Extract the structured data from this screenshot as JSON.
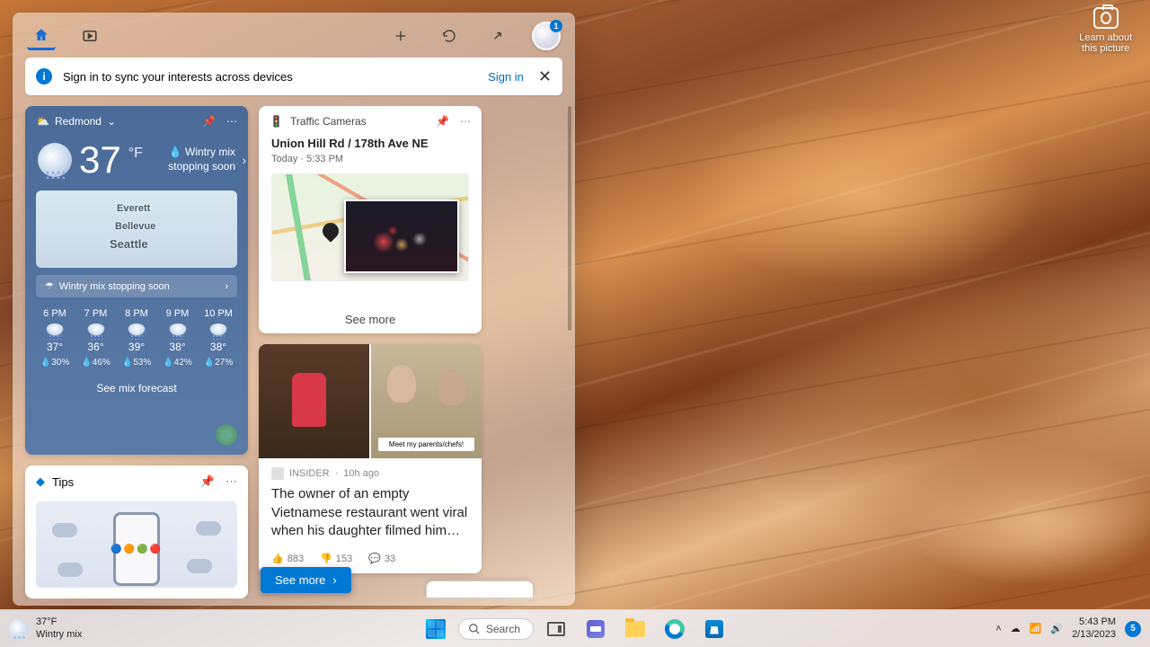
{
  "panel": {
    "signin_msg": "Sign in to sync your interests across devices",
    "signin_link": "Sign in",
    "avatar_badge": "1",
    "see_more_btn": "See more"
  },
  "weather": {
    "location": "Redmond",
    "temp": "37",
    "unit": "°F",
    "desc_icon": "💧",
    "desc": "Wintry mix stopping soon",
    "map_cities": {
      "everett": "Everett",
      "bellevue": "Bellevue",
      "seattle": "Seattle"
    },
    "banner": "Wintry mix stopping soon",
    "hourly": [
      {
        "time": "6 PM",
        "temp": "37°",
        "precip": "30%"
      },
      {
        "time": "7 PM",
        "temp": "36°",
        "precip": "46%"
      },
      {
        "time": "8 PM",
        "temp": "39°",
        "precip": "53%"
      },
      {
        "time": "9 PM",
        "temp": "38°",
        "precip": "42%"
      },
      {
        "time": "10 PM",
        "temp": "38°",
        "precip": "27%"
      }
    ],
    "see_forecast": "See mix forecast"
  },
  "tips": {
    "title": "Tips"
  },
  "traffic": {
    "title": "Traffic Cameras",
    "location": "Union Hill Rd / 178th Ave NE",
    "meta": "Today · 5:33 PM",
    "see_more": "See more"
  },
  "news": {
    "caption_b": "Meet my parents/chefs!",
    "source": "INSIDER",
    "time": "10h ago",
    "headline": "The owner of an empty Vietnamese restaurant went viral when his daughter filmed him…",
    "likes": "883",
    "dislikes": "153",
    "comments": "33"
  },
  "learn_picture": {
    "line1": "Learn about",
    "line2": "this picture"
  },
  "taskbar": {
    "weather_temp": "37°F",
    "weather_desc": "Wintry mix",
    "search": "Search",
    "time": "5:43 PM",
    "date": "2/13/2023",
    "notif": "5"
  }
}
